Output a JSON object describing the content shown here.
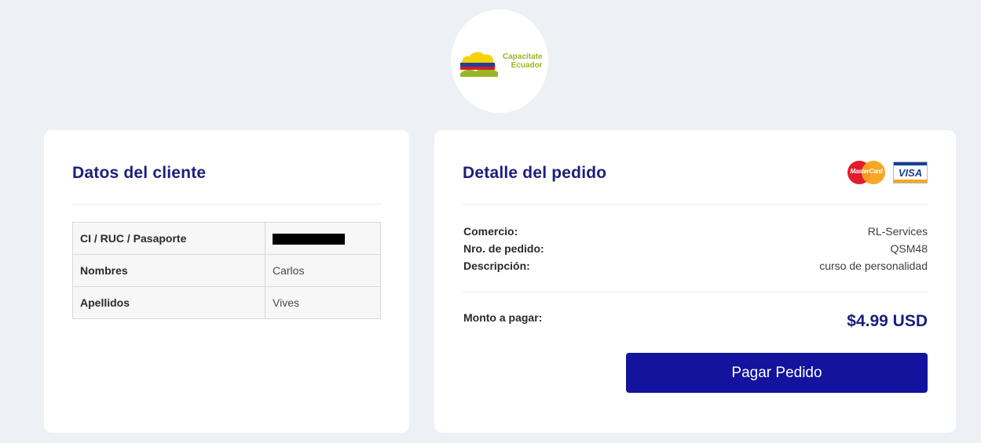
{
  "brand": {
    "logo_line1": "Capacitate",
    "logo_line2": "Ecuador",
    "accent_color": "#9ab723"
  },
  "client": {
    "title": "Datos del cliente",
    "rows": [
      {
        "label": "CI / RUC / Pasaporte",
        "value": ""
      },
      {
        "label": "Nombres",
        "value": "Carlos"
      },
      {
        "label": "Apellidos",
        "value": "Vives"
      }
    ]
  },
  "order": {
    "title": "Detalle del pedido",
    "payment_icons": [
      "mastercard-icon",
      "visa-icon"
    ],
    "mastercard_label": "MasterCard",
    "visa_label": "VISA",
    "rows": [
      {
        "label": "Comercio:",
        "value": "RL-Services"
      },
      {
        "label": "Nro. de pedido:",
        "value": "QSM48"
      },
      {
        "label": "Descripción:",
        "value": "curso de personalidad"
      }
    ],
    "amount_label": "Monto a pagar:",
    "amount_value": "$4.99 USD",
    "pay_button_label": "Pagar Pedido",
    "primary_color": "#13139d",
    "heading_color": "#1b1f7a"
  }
}
